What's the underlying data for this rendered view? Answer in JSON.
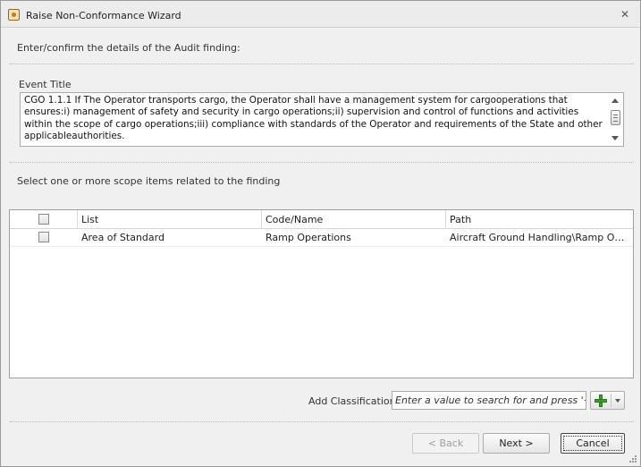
{
  "window": {
    "title": "Raise Non-Conformance Wizard",
    "icons": {
      "app": "wizard-app-icon",
      "close": "close-icon"
    }
  },
  "instructions": {
    "top": "Enter/confirm the details of the Audit finding:",
    "scope": "Select one or more scope items related to the finding"
  },
  "event": {
    "label": "Event Title",
    "text": "CGO 1.1.1 If The Operator transports cargo, the Operator shall have a management system for cargooperations that ensures:i) management of safety and security in cargo operations;ii) supervision and control of functions and activities within the scope of cargo operations;iii) compliance with standards of the Operator and requirements of the State and other applicableauthorities."
  },
  "grid": {
    "columns": [
      "List",
      "Code/Name",
      "Path"
    ],
    "rows": [
      {
        "checked": false,
        "list": "Area of Standard",
        "code": "Ramp Operations",
        "path": "Aircraft Ground Handling\\Ramp Operati..."
      }
    ]
  },
  "classification": {
    "label": "Add Classification:",
    "placeholder": "Enter a value to search for and press '+'"
  },
  "buttons": {
    "back": "< Back",
    "next": "Next >",
    "cancel": "Cancel"
  }
}
